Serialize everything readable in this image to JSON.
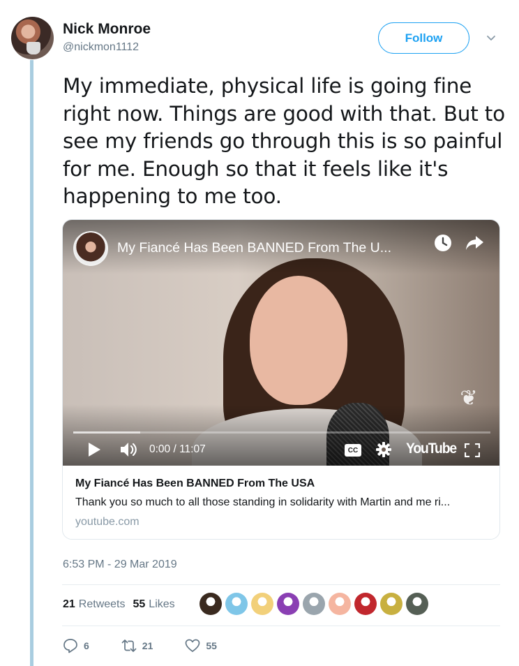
{
  "author": {
    "name": "Nick Monroe",
    "handle": "@nickmon1112"
  },
  "follow_label": "Follow",
  "tweet_text": "My immediate, physical life is going fine right now. Things are good with that. But to see my friends go through this is so painful for me. Enough so that it feels like it's happening to me too.",
  "video": {
    "title": "My Fiancé Has Been BANNED From The U...",
    "time": "0:00 / 11:07",
    "cc_label": "CC",
    "platform_logo": "YouTube",
    "buffer_fraction": 0.16
  },
  "card": {
    "title": "My Fiancé Has Been BANNED From The USA",
    "description": "Thank you so much to all those standing in solidarity with Martin and me ri...",
    "domain": "youtube.com"
  },
  "timestamp": "6:53 PM - 29 Mar 2019",
  "stats": {
    "retweets_count": "21",
    "retweets_label": "Retweets",
    "likes_count": "55",
    "likes_label": "Likes"
  },
  "liker_avatar_colors": [
    "#3a2a1f",
    "#7fc6e8",
    "#f2d07a",
    "#8a3fb3",
    "#9aa5ad",
    "#f5b5a0",
    "#c1272d",
    "#c8b040",
    "#555f55"
  ],
  "actions": {
    "reply_count": "6",
    "retweet_count": "21",
    "like_count": "55"
  },
  "colors": {
    "accent": "#1da1f2",
    "thread_line": "#a9cde0",
    "secondary_text": "#657786"
  }
}
